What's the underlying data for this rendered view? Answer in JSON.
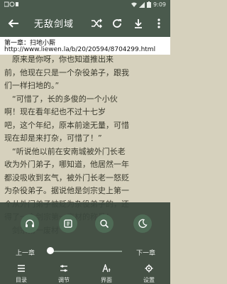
{
  "status": {
    "time": "9:09"
  },
  "appbar": {
    "title": "无敌剑域"
  },
  "url": {
    "chapter": "第一章：扫地小厮",
    "address": "http://www.liewen.la/b/20/20594/8704299.html"
  },
  "content": {
    "lines": [
      "　原来是你呀，你也知道推出来",
      "前，他现在只是一个杂役弟子，跟我",
      "们一样扫地的。”",
      "　“可惜了，长的多俊的一个小伙",
      "啊！现在看年纪也不过十七岁",
      "吧，这个年纪，原本前途无量，可惜",
      "现在却是来打杂，可惜了！”",
      "　“听说他以前在安南城被外门长老",
      "收为外门弟子，哪知道，他居然一年",
      "都没吸收到玄气，被外门长老一怒贬",
      "为杂役弟子。据说他是剑宗史上第一",
      "个从外门弟子被贬为杂役弟子的，还",
      "得了一个剑宗第一废材的称号！",
      "　剑宗第一废材"
    ]
  },
  "nav": {
    "prev": "上一章",
    "next": "下一章",
    "progress": 0.0
  },
  "bottom_nav": [
    {
      "label": "目录",
      "icon": "menu-list-icon"
    },
    {
      "label": "调节",
      "icon": "sliders-icon"
    },
    {
      "label": "界面",
      "icon": "font-icon"
    },
    {
      "label": "设置",
      "icon": "gear-icon"
    }
  ]
}
